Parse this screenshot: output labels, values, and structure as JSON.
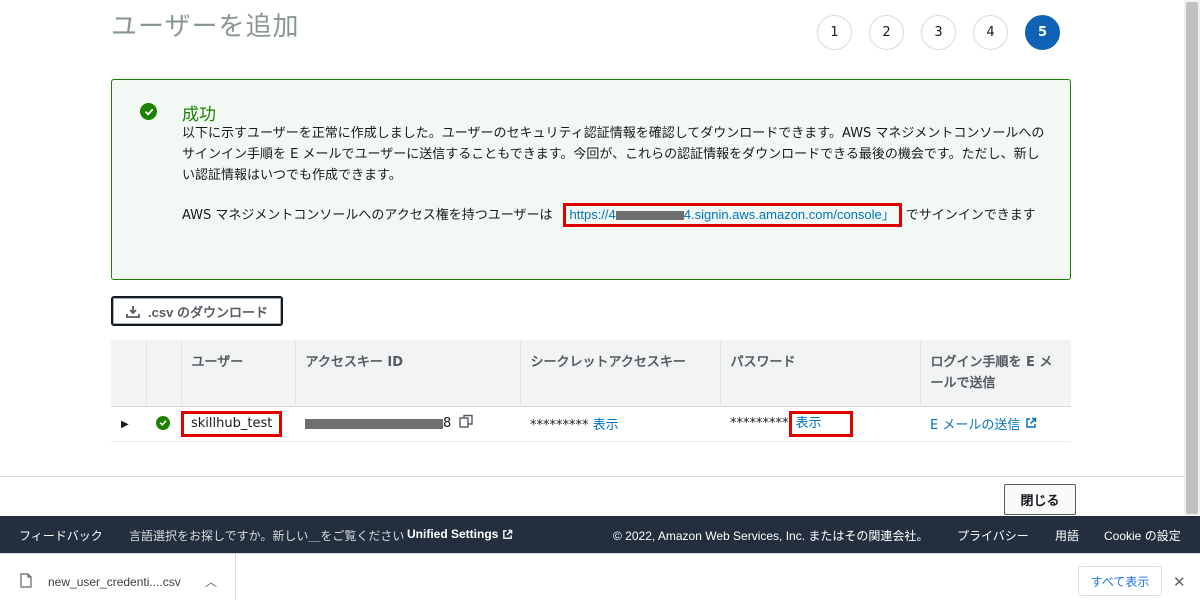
{
  "page": {
    "title": "ユーザーを追加"
  },
  "steps": [
    "1",
    "2",
    "3",
    "4",
    "5"
  ],
  "success": {
    "title": "成功",
    "message": "以下に示すユーザーを正常に作成しました。ユーザーのセキュリティ認証情報を確認してダウンロードできます。AWS マネジメントコンソールへのサインイン手順を E メールでユーザーに送信することもできます。今回が、これらの認証情報をダウンロードできる最後の機会です。ただし、新しい認証情報はいつでも作成できます。",
    "signin_prefix": "AWS マネジメントコンソールへのアクセス権を持つユーザーは",
    "signin_url_start": "https://4",
    "signin_url_end": "4.signin.aws.amazon.com/console",
    "signin_suffix": "でサインインできます"
  },
  "download_csv_label": ".csv のダウンロード",
  "table": {
    "headers": [
      "ユーザー",
      "アクセスキー ID",
      "シークレットアクセスキー",
      "パスワード",
      "ログイン手順を E メールで送信"
    ],
    "row": {
      "user": "skillhub_test",
      "access_key_tail": "8",
      "secret_mask": "*********",
      "secret_show": "表示",
      "password_mask": "*********",
      "password_show": "表示",
      "email_send": "E メールの送信"
    }
  },
  "close_label": "閉じる",
  "console_footer": {
    "feedback": "フィードバック",
    "language_prompt": "言語選択をお探しですか。新しい＿をご覧ください",
    "unified_settings": "Unified Settings",
    "copyright": "© 2022, Amazon Web Services, Inc. またはその関連会社。",
    "privacy": "プライバシー",
    "terms": "用語",
    "cookie": "Cookie の設定"
  },
  "download_bar": {
    "filename": "new_user_credenti....csv",
    "show_all": "すべて表示"
  },
  "colors": {
    "success": "#1d8102",
    "link": "#0073bb",
    "active_step": "#0f62b5",
    "footer_bg": "#232f3e",
    "highlight": "#e00000"
  }
}
